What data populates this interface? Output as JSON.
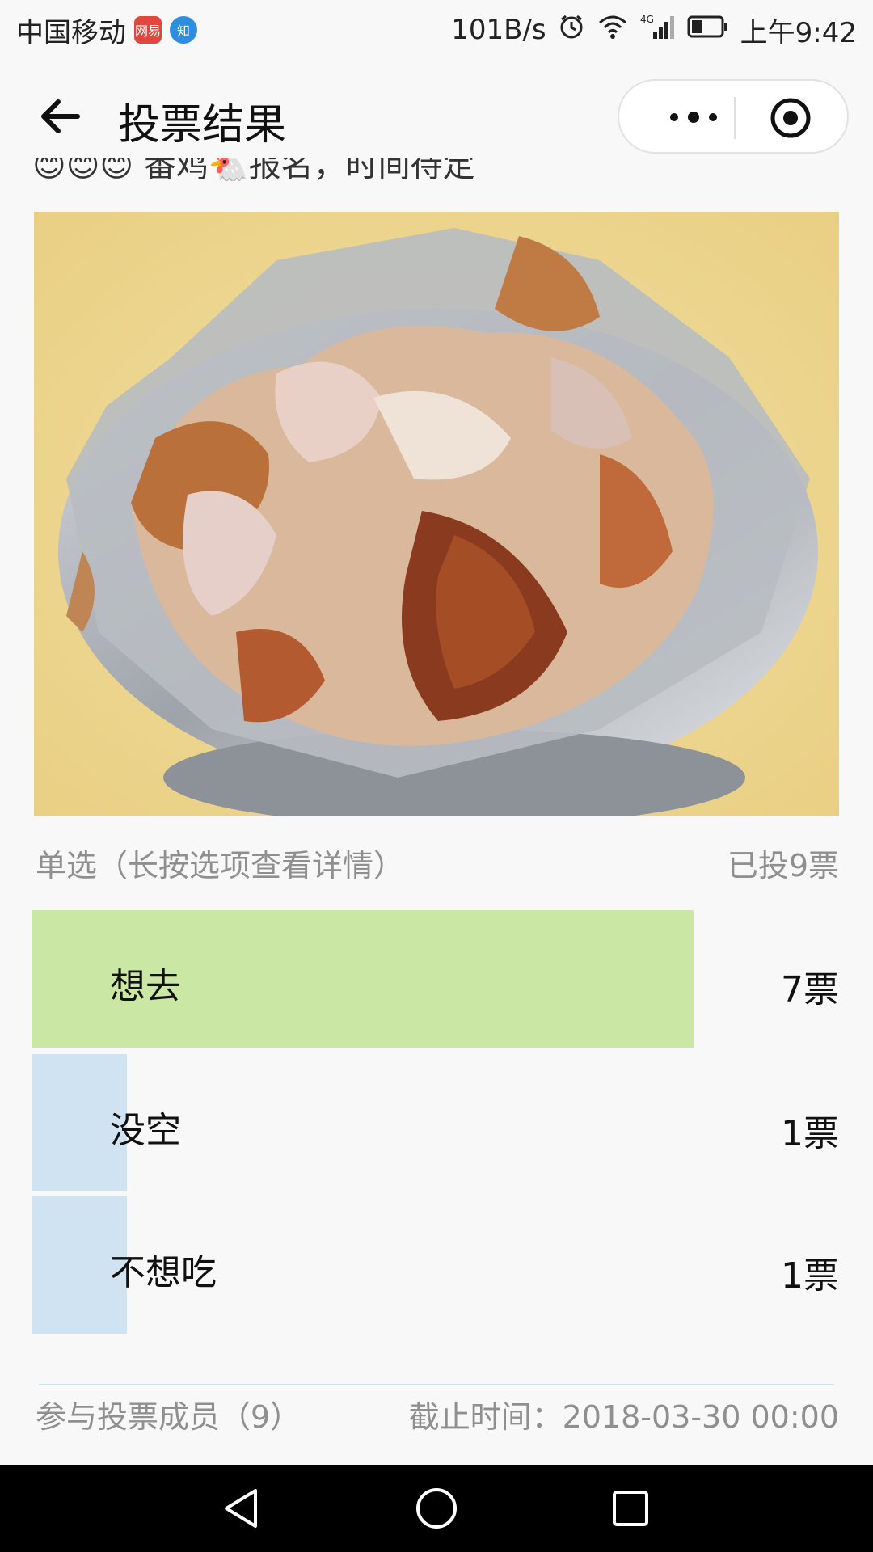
{
  "status_bar": {
    "carrier": "中国移动",
    "badge1": "网易",
    "badge2": "知",
    "speed": "101B/s",
    "network": "4G",
    "time": "上午9:42"
  },
  "nav": {
    "title": "投票结果"
  },
  "post": {
    "partial_text": "😊😊😊 番鸡🐔报名，时间待定"
  },
  "poll": {
    "type_hint": "单选（长按选项查看详情）",
    "total": "已投9票",
    "options": [
      {
        "label": "想去",
        "count": "7票",
        "votes": 7,
        "share": 0.778,
        "color": "#cbe7a4"
      },
      {
        "label": "没空",
        "count": "1票",
        "votes": 1,
        "share": 0.111,
        "color": "#cfe3f2"
      },
      {
        "label": "不想吃",
        "count": "1票",
        "votes": 1,
        "share": 0.111,
        "color": "#cfe3f2"
      }
    ]
  },
  "footer": {
    "members": "参与投票成员（9）",
    "deadline": "截止时间：2018-03-30 00:00"
  }
}
